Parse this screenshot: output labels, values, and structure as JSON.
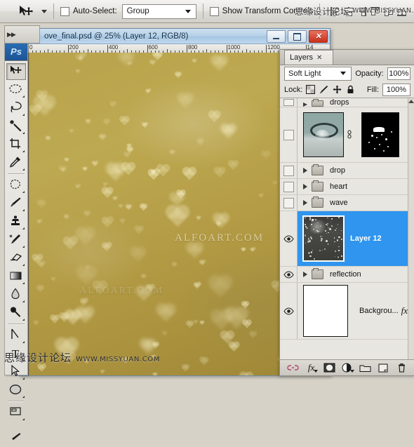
{
  "options_bar": {
    "tool_icon": "move-tool-icon",
    "auto_select_label": "Auto-Select:",
    "auto_select_value": "Group",
    "show_transform_label": "Show Transform Controls",
    "watermark_cn": "思缘设计论坛",
    "watermark_en": "WWW.MISSYUAN.COM"
  },
  "toolbar": {
    "logo": "Ps",
    "tools": [
      {
        "name": "move-tool",
        "icon": "move-arrow-icon"
      },
      {
        "name": "marquee-tool",
        "icon": "elliptical-marquee-icon"
      },
      {
        "name": "lasso-tool",
        "icon": "lasso-icon"
      },
      {
        "name": "magic-wand-tool",
        "icon": "magic-wand-icon"
      },
      {
        "name": "crop-tool",
        "icon": "crop-icon"
      },
      {
        "name": "eyedropper-tool",
        "icon": "eyedropper-icon"
      },
      {
        "name": "healing-brush-tool",
        "icon": "healing-patch-icon"
      },
      {
        "name": "brush-tool",
        "icon": "paintbrush-icon"
      },
      {
        "name": "clone-stamp-tool",
        "icon": "clone-stamp-icon"
      },
      {
        "name": "history-brush-tool",
        "icon": "history-brush-icon"
      },
      {
        "name": "eraser-tool",
        "icon": "eraser-icon"
      },
      {
        "name": "gradient-tool",
        "icon": "gradient-icon"
      },
      {
        "name": "blur-tool",
        "icon": "waterdrop-icon"
      },
      {
        "name": "dodge-tool",
        "icon": "dodge-burn-icon"
      },
      {
        "name": "pen-tool",
        "icon": "pen-icon"
      },
      {
        "name": "type-tool",
        "icon": "type-T-icon"
      },
      {
        "name": "path-selection-tool",
        "icon": "path-arrow-icon"
      },
      {
        "name": "shape-tool",
        "icon": "ellipse-shape-icon"
      },
      {
        "name": "notes-tool",
        "icon": "notes-icon"
      }
    ]
  },
  "document": {
    "title": "ove_final.psd @ 25% (Layer 12, RGB/8)",
    "window_buttons": [
      "minimize",
      "maximize",
      "close"
    ],
    "ruler_labels": [
      "0",
      "200",
      "400",
      "600",
      "800",
      "1000",
      "1200",
      "14"
    ],
    "canvas_watermark_1": "ALFOART.COM",
    "canvas_watermark_2": "ALFOART.COM",
    "canvas_color": "#b9a34c"
  },
  "page_watermark": {
    "cn": "思缘设计论坛",
    "en": "WWW.MISSYUAN.COM"
  },
  "layers_panel": {
    "tab_label": "Layers",
    "tab_close": "✕",
    "blend_mode": "Soft Light",
    "opacity_label": "Opacity:",
    "opacity_value": "100%",
    "lock_label": "Lock:",
    "fill_label": "Fill:",
    "fill_value": "100%",
    "lock_icons": [
      "lock-transparent-pixels-icon",
      "lock-image-pixels-icon",
      "lock-position-icon",
      "lock-all-icon"
    ],
    "partial_top_layer": "drops",
    "layers": [
      {
        "name": "",
        "type": "image-with-mask",
        "visible": false,
        "selected": false,
        "has_mask": true,
        "thumb": "water-drop-thumbnail",
        "mask_thumb": "splash-mask-thumbnail"
      },
      {
        "name": "drop",
        "type": "group",
        "visible": false,
        "selected": false
      },
      {
        "name": "heart",
        "type": "group",
        "visible": false,
        "selected": false
      },
      {
        "name": "wave",
        "type": "group",
        "visible": false,
        "selected": false
      },
      {
        "name": "Layer 12",
        "type": "image",
        "visible": true,
        "selected": true,
        "thumb": "dark-sparkle-thumbnail"
      },
      {
        "name": "reflection",
        "type": "group",
        "visible": true,
        "selected": false
      },
      {
        "name": "Backgrou...",
        "type": "image",
        "visible": true,
        "selected": false,
        "fx": "fx",
        "thumb": "white-thumbnail"
      }
    ],
    "bottom_buttons": [
      {
        "name": "link-layers-button",
        "icon": "link-icon"
      },
      {
        "name": "layer-style-button",
        "icon": "fx-icon"
      },
      {
        "name": "add-layer-mask-button",
        "icon": "mask-circle-icon"
      },
      {
        "name": "adjustment-layer-button",
        "icon": "half-circle-icon"
      },
      {
        "name": "new-group-button",
        "icon": "folder-icon"
      },
      {
        "name": "new-layer-button",
        "icon": "new-layer-icon"
      },
      {
        "name": "delete-layer-button",
        "icon": "trash-icon"
      }
    ]
  }
}
